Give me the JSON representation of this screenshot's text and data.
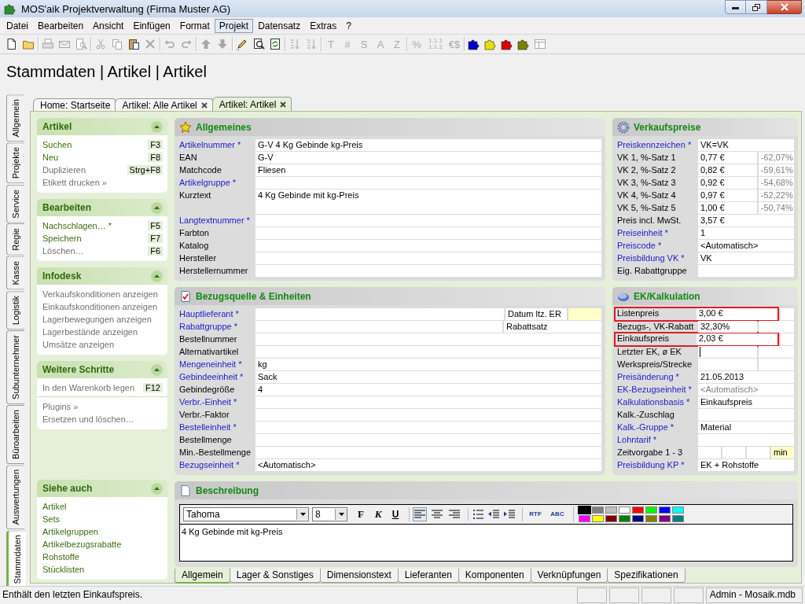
{
  "window": {
    "title": "MOS'aik Projektverwaltung (Firma Muster AG)"
  },
  "menu": [
    {
      "label": "Datei",
      "selected": false
    },
    {
      "label": "Bearbeiten",
      "selected": false
    },
    {
      "label": "Ansicht",
      "selected": false
    },
    {
      "label": "Einfügen",
      "selected": false
    },
    {
      "label": "Format",
      "selected": false
    },
    {
      "label": "Projekt",
      "selected": true
    },
    {
      "label": "Datensatz",
      "selected": false
    },
    {
      "label": "Extras",
      "selected": false
    },
    {
      "label": "?",
      "selected": false
    }
  ],
  "toolbar": [
    [
      {
        "kind": "new",
        "disabled": false
      },
      {
        "kind": "open",
        "disabled": false
      }
    ],
    [
      {
        "kind": "print",
        "disabled": true
      },
      {
        "kind": "mail",
        "disabled": true
      },
      {
        "kind": "preview",
        "disabled": true
      }
    ],
    [
      {
        "kind": "cut",
        "disabled": true
      },
      {
        "kind": "copy",
        "disabled": true
      },
      {
        "kind": "paste",
        "disabled": false
      },
      {
        "kind": "delete",
        "disabled": true
      }
    ],
    [
      {
        "kind": "undo",
        "disabled": true
      },
      {
        "kind": "redo",
        "disabled": true
      }
    ],
    [
      {
        "kind": "up",
        "disabled": true
      },
      {
        "kind": "down",
        "disabled": true
      }
    ],
    [
      {
        "kind": "edit",
        "disabled": false
      },
      {
        "kind": "find",
        "disabled": false
      },
      {
        "kind": "refresh",
        "disabled": false
      }
    ],
    [
      {
        "kind": "sort_asc",
        "disabled": true
      },
      {
        "kind": "sort_desc",
        "disabled": true
      }
    ],
    [
      {
        "kind": "glyph",
        "text": "T",
        "disabled": true
      },
      {
        "kind": "glyph",
        "text": "#",
        "disabled": true
      },
      {
        "kind": "glyph",
        "text": "S",
        "disabled": true
      },
      {
        "kind": "glyph",
        "text": "A",
        "disabled": true
      },
      {
        "kind": "glyph",
        "text": "Z",
        "disabled": true
      }
    ],
    [
      {
        "kind": "glyph",
        "text": "%",
        "disabled": true
      },
      {
        "kind": "stacked",
        "text": "1.1.1 1.1.2",
        "disabled": true
      },
      {
        "kind": "glyph",
        "text": "€$",
        "disabled": true
      }
    ],
    [
      {
        "kind": "puzzle",
        "color": "#0000cc",
        "disabled": false
      },
      {
        "kind": "puzzle",
        "color": "#e8e000",
        "disabled": false
      },
      {
        "kind": "puzzle",
        "color": "#dd0000",
        "disabled": false
      },
      {
        "kind": "puzzle",
        "color": "#808000",
        "disabled": false
      },
      {
        "kind": "table",
        "disabled": true
      }
    ]
  ],
  "page_title": "Stammdaten | Artikel | Artikel",
  "side_tabs": [
    {
      "label": "Allgemein",
      "selected": false
    },
    {
      "label": "Projekte",
      "selected": false
    },
    {
      "label": "Service",
      "selected": false
    },
    {
      "label": "Regie",
      "selected": false
    },
    {
      "label": "Kasse",
      "selected": false
    },
    {
      "label": "Logistik",
      "selected": false
    },
    {
      "label": "Subunternehmer",
      "selected": false
    },
    {
      "label": "Büroarbeiten",
      "selected": false
    },
    {
      "label": "Auswertungen",
      "selected": false
    },
    {
      "label": "Stammdaten",
      "selected": true
    }
  ],
  "doc_tabs": [
    {
      "label": "Home: Startseite",
      "closable": false,
      "selected": false
    },
    {
      "label": "Artikel: Alle Artikel",
      "closable": true,
      "selected": false
    },
    {
      "label": "Artikel: Artikel",
      "closable": true,
      "selected": true
    }
  ],
  "task_sections": [
    {
      "title": "Artikel",
      "expanded": true,
      "groups": [
        [
          {
            "label": "Suchen",
            "shortcut": "F3",
            "disabled": false
          },
          {
            "label": "Neu",
            "shortcut": "F8",
            "disabled": false
          },
          {
            "label": "Duplizieren",
            "shortcut": "Strg+F8",
            "disabled": true
          },
          {
            "label": "Etikett drucken »",
            "disabled": true
          }
        ]
      ]
    },
    {
      "title": "Bearbeiten",
      "expanded": true,
      "groups": [
        [
          {
            "label": "Nachschlagen… *",
            "shortcut": "F5",
            "disabled": false
          },
          {
            "label": "Speichern",
            "shortcut": "F7",
            "disabled": false
          },
          {
            "label": "Löschen…",
            "shortcut": "F6",
            "disabled": true
          }
        ]
      ]
    },
    {
      "title": "Infodesk",
      "expanded": true,
      "groups": [
        [
          {
            "label": "Verkaufskonditionen anzeigen",
            "disabled": true
          },
          {
            "label": "Einkaufskonditionen anzeigen",
            "disabled": true
          },
          {
            "label": "Lagerbewegungen anzeigen",
            "disabled": true
          },
          {
            "label": "Lagerbestände anzeigen",
            "disabled": true
          },
          {
            "label": "Umsätze anzeigen",
            "disabled": true
          }
        ]
      ]
    },
    {
      "title": "Weitere Schritte",
      "expanded": true,
      "groups": [
        [
          {
            "label": "In den Warenkorb legen",
            "shortcut": "F12",
            "disabled": true
          }
        ],
        [
          {
            "label": "Plugins »",
            "disabled": true
          },
          {
            "label": "Ersetzen und löschen…",
            "disabled": true
          }
        ]
      ]
    },
    {
      "title": "Siehe auch",
      "expanded": true,
      "groups": [
        [
          {
            "label": "Artikel",
            "disabled": false
          },
          {
            "label": "Sets",
            "disabled": false
          },
          {
            "label": "Artikelgruppen",
            "disabled": false
          },
          {
            "label": "Artikelbezugsrabatte",
            "disabled": false
          },
          {
            "label": "Rohstoffe",
            "disabled": false
          },
          {
            "label": "Stücklisten",
            "disabled": false
          }
        ]
      ]
    }
  ],
  "general": {
    "title": "Allgemeines",
    "rows": [
      {
        "label": "Artikelnummer *",
        "required": true,
        "kind": "line",
        "cells": [
          {
            "value": "G-V 4 Kg Gebinde kg-Preis"
          }
        ]
      },
      {
        "label": "EAN",
        "required": false,
        "kind": "line",
        "cells": [
          {
            "value": "G-V"
          }
        ]
      },
      {
        "label": "Matchcode",
        "required": false,
        "kind": "line",
        "cells": [
          {
            "value": "Fliesen"
          }
        ]
      },
      {
        "label": "Artikelgruppe *",
        "required": true,
        "kind": "line",
        "cells": [
          {}
        ]
      },
      {
        "label": "Kurztext",
        "required": false,
        "kind": "textarea",
        "cells": [
          {
            "value": "4 Kg Gebinde mit kg-Preis"
          }
        ]
      },
      {
        "label": "Langtextnummer *",
        "required": true,
        "kind": "line",
        "cells": [
          {}
        ]
      },
      {
        "label": "Farbton",
        "required": false,
        "kind": "line",
        "cells": [
          {}
        ]
      },
      {
        "label": "Katalog",
        "required": false,
        "kind": "line",
        "cells": [
          {}
        ]
      },
      {
        "label": "Hersteller",
        "required": false,
        "kind": "line",
        "cells": [
          {}
        ]
      },
      {
        "label": "Herstellernummer",
        "required": false,
        "kind": "line",
        "cells": [
          {}
        ]
      }
    ]
  },
  "supply": {
    "title": "Bezugsquelle & Einheiten",
    "rows": [
      {
        "label": "Hauptlieferant *",
        "required": true,
        "cells": [
          {},
          {
            "label": "Datum ltz. ER"
          },
          {
            "highlighted": true
          }
        ]
      },
      {
        "label": "Rabattgruppe *",
        "required": true,
        "cells": [
          {},
          {
            "label": "Rabattsatz"
          }
        ]
      },
      {
        "label": "Bestellnummer",
        "required": false,
        "cells": [
          {}
        ]
      },
      {
        "label": "Alternativartikel",
        "required": false,
        "cells": [
          {}
        ]
      },
      {
        "label": "Mengeneinheit *",
        "required": true,
        "cells": [
          {
            "value": "kg"
          }
        ]
      },
      {
        "label": "Gebindeeinheit *",
        "required": true,
        "cells": [
          {
            "value": "Sack"
          }
        ]
      },
      {
        "label": "Gebindegröße",
        "required": false,
        "cells": [
          {
            "value": "4"
          }
        ]
      },
      {
        "label": "Verbr.-Einheit *",
        "required": true,
        "cells": [
          {}
        ]
      },
      {
        "label": "Verbr.-Faktor",
        "required": false,
        "cells": [
          {}
        ]
      },
      {
        "label": "Bestelleinheit *",
        "required": true,
        "cells": [
          {}
        ]
      },
      {
        "label": "Bestellmenge",
        "required": false,
        "cells": [
          {}
        ]
      },
      {
        "label": "Min.-Bestellmenge",
        "required": false,
        "cells": [
          {}
        ]
      },
      {
        "label": "Bezugseinheit *",
        "required": true,
        "cells": [
          {
            "value": "<Automatisch>"
          }
        ]
      }
    ]
  },
  "sales_prices": {
    "title": "Verkaufspreise",
    "rows": [
      {
        "label": "Preiskennzeichen *",
        "required": true,
        "cells": [
          {
            "value": "VK=VK"
          }
        ]
      },
      {
        "label": "VK 1, %-Satz 1",
        "required": false,
        "cells": [
          {
            "value": "0,77 €"
          },
          {
            "value": "-62,07%",
            "muted": true
          }
        ]
      },
      {
        "label": "VK 2, %-Satz 2",
        "required": false,
        "cells": [
          {
            "value": "0,82 €"
          },
          {
            "value": "-59,61%",
            "muted": true
          }
        ]
      },
      {
        "label": "VK 3, %-Satz 3",
        "required": false,
        "cells": [
          {
            "value": "0,92 €"
          },
          {
            "value": "-54,68%",
            "muted": true
          }
        ]
      },
      {
        "label": "VK 4, %-Satz 4",
        "required": false,
        "cells": [
          {
            "value": "0,97 €"
          },
          {
            "value": "-52,22%",
            "muted": true
          }
        ]
      },
      {
        "label": "VK 5, %-Satz 5",
        "required": false,
        "cells": [
          {
            "value": "1,00 €"
          },
          {
            "value": "-50,74%",
            "muted": true
          }
        ]
      },
      {
        "label": "Preis incl. MwSt.",
        "required": false,
        "cells": [
          {
            "value": "3,57 €"
          }
        ]
      },
      {
        "label": "Preiseinheit *",
        "required": true,
        "cells": [
          {
            "value": "1"
          }
        ]
      },
      {
        "label": "Preiscode *",
        "required": true,
        "cells": [
          {
            "value": "<Automatisch>"
          }
        ]
      },
      {
        "label": "Preisbildung VK *",
        "required": true,
        "cells": [
          {
            "value": "VK"
          }
        ]
      },
      {
        "label": "Eig. Rabattgruppe",
        "required": false,
        "cells": [
          {}
        ]
      }
    ]
  },
  "purchase": {
    "title": "EK/Kalkulation",
    "rows": [
      {
        "label": "Listenpreis",
        "required": false,
        "flagged": true,
        "cells": [
          {
            "value": "3,00 €"
          },
          {}
        ]
      },
      {
        "label": "Bezugs-, VK-Rabatt",
        "required": false,
        "flagged": false,
        "cells": [
          {
            "value": "32,30%"
          },
          {}
        ]
      },
      {
        "label": "Einkaufspreis",
        "required": false,
        "flagged": true,
        "cells": [
          {
            "value": "2,03 €"
          },
          {}
        ]
      },
      {
        "label": "Letzter EK, ø EK",
        "required": false,
        "flagged": false,
        "cells": [
          {
            "focused": true
          },
          {}
        ]
      },
      {
        "label": "Werkspreis/Strecke",
        "required": false,
        "flagged": false,
        "cells": [
          {},
          {}
        ]
      },
      {
        "label": "Preisänderung *",
        "required": true,
        "flagged": false,
        "cells": [
          {
            "value": "21.05.2013"
          }
        ]
      },
      {
        "label": "EK-Bezugseinheit *",
        "required": true,
        "flagged": false,
        "cells": [
          {
            "value": "<Automatisch>",
            "muted": true
          }
        ]
      },
      {
        "label": "Kalkulationsbasis *",
        "required": true,
        "flagged": false,
        "cells": [
          {
            "value": "Einkaufspreis"
          }
        ]
      },
      {
        "label": "Kalk.-Zuschlag",
        "required": false,
        "flagged": false,
        "cells": [
          {}
        ]
      },
      {
        "label": "Kalk.-Gruppe *",
        "required": true,
        "flagged": false,
        "cells": [
          {
            "value": "Material"
          }
        ]
      },
      {
        "label": "Lohntarif *",
        "required": true,
        "flagged": false,
        "cells": [
          {}
        ]
      },
      {
        "label": "Zeitvorgabe 1 - 3",
        "required": false,
        "flagged": false,
        "cells": [
          {},
          {},
          {},
          {
            "value": "min",
            "highlighted": true
          }
        ]
      },
      {
        "label": "Preisbildung KP *",
        "required": true,
        "flagged": false,
        "cells": [
          {
            "value": "EK + Rohstoffe"
          }
        ]
      }
    ]
  },
  "description": {
    "title": "Beschreibung",
    "font": "Tahoma",
    "size": "8",
    "tools": [
      [
        {
          "kind": "bold",
          "text": "F"
        },
        {
          "kind": "italic",
          "text": "K"
        },
        {
          "kind": "underline",
          "text": "U"
        }
      ],
      [
        {
          "kind": "align_left",
          "selected": true
        },
        {
          "kind": "align_center",
          "selected": false
        },
        {
          "kind": "align_right",
          "selected": false
        }
      ],
      [
        {
          "kind": "bullets"
        },
        {
          "kind": "outdent"
        },
        {
          "kind": "indent"
        }
      ],
      [
        {
          "kind": "rtf",
          "text": "RTF"
        },
        {
          "kind": "spell",
          "text": "ABC"
        }
      ]
    ],
    "palette": [
      {
        "color": "#000000",
        "selected": true
      },
      {
        "color": "#808080",
        "selected": false
      },
      {
        "color": "#c0c0c0",
        "selected": false
      },
      {
        "color": "#ffffff",
        "selected": false
      },
      {
        "color": "#ff0000",
        "selected": false
      },
      {
        "color": "#00ff00",
        "selected": false
      },
      {
        "color": "#0000ff",
        "selected": false
      },
      {
        "color": "#00ffff",
        "selected": false
      },
      {
        "color": "#ff00ff",
        "selected": false
      },
      {
        "color": "#ffff00",
        "selected": false
      },
      {
        "color": "#800000",
        "selected": false
      },
      {
        "color": "#008000",
        "selected": false
      },
      {
        "color": "#000080",
        "selected": false
      },
      {
        "color": "#808000",
        "selected": false
      },
      {
        "color": "#800080",
        "selected": false
      },
      {
        "color": "#008080",
        "selected": false
      }
    ],
    "text": "4 Kg Gebinde mit kg-Preis"
  },
  "bottom_tabs": [
    {
      "label": "Allgemein",
      "selected": true
    },
    {
      "label": "Lager & Sonstiges",
      "selected": false
    },
    {
      "label": "Dimensionstext",
      "selected": false
    },
    {
      "label": "Lieferanten",
      "selected": false
    },
    {
      "label": "Komponenten",
      "selected": false
    },
    {
      "label": "Verknüpfungen",
      "selected": false
    },
    {
      "label": "Spezifikationen",
      "selected": false
    }
  ],
  "status_bar": {
    "message": "Enthält den letzten Einkaufspreis.",
    "info": "Admin - Mosaik.mdb"
  }
}
